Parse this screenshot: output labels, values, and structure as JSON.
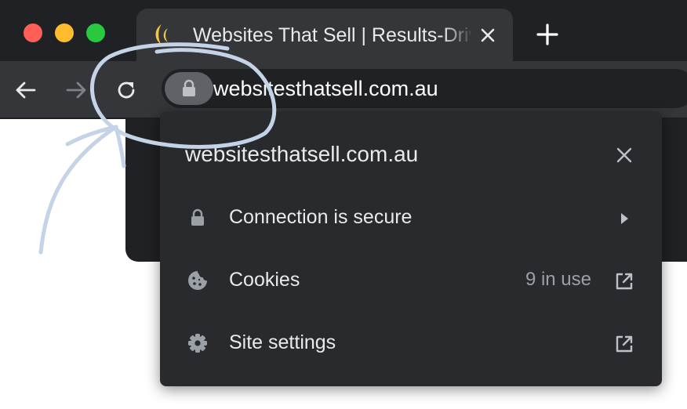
{
  "window": {
    "controls": [
      "close-icon",
      "minimize-icon",
      "zoom-icon"
    ]
  },
  "tab": {
    "title": "Websites That Sell | Results-Driven",
    "favicon": "crescent-logo-icon",
    "close_icon": "close-icon"
  },
  "toolbar": {
    "new_tab_icon": "plus-icon",
    "back_icon": "arrow-left-icon",
    "forward_icon": "arrow-right-icon",
    "reload_icon": "reload-icon",
    "site_info_icon": "lock-icon",
    "url": "websitesthatsell.com.au"
  },
  "site_info_popup": {
    "title": "websitesthatsell.com.au",
    "close_icon": "close-icon",
    "items": [
      {
        "label": "Connection is secure",
        "icon": "lock-icon",
        "meta": "",
        "action_icon": "chevron-right-icon"
      },
      {
        "label": "Cookies",
        "icon": "cookie-icon",
        "meta": "9 in use",
        "action_icon": "external-link-icon"
      },
      {
        "label": "Site settings",
        "icon": "gear-icon",
        "meta": "",
        "action_icon": "external-link-icon"
      }
    ]
  },
  "colors": {
    "frame": "#202124",
    "toolbar": "#35363a",
    "popup": "#292a2d",
    "text": "#e8eaed",
    "secondary_text": "#9aa0a6",
    "annotation_stroke": "#c5d3e6"
  }
}
